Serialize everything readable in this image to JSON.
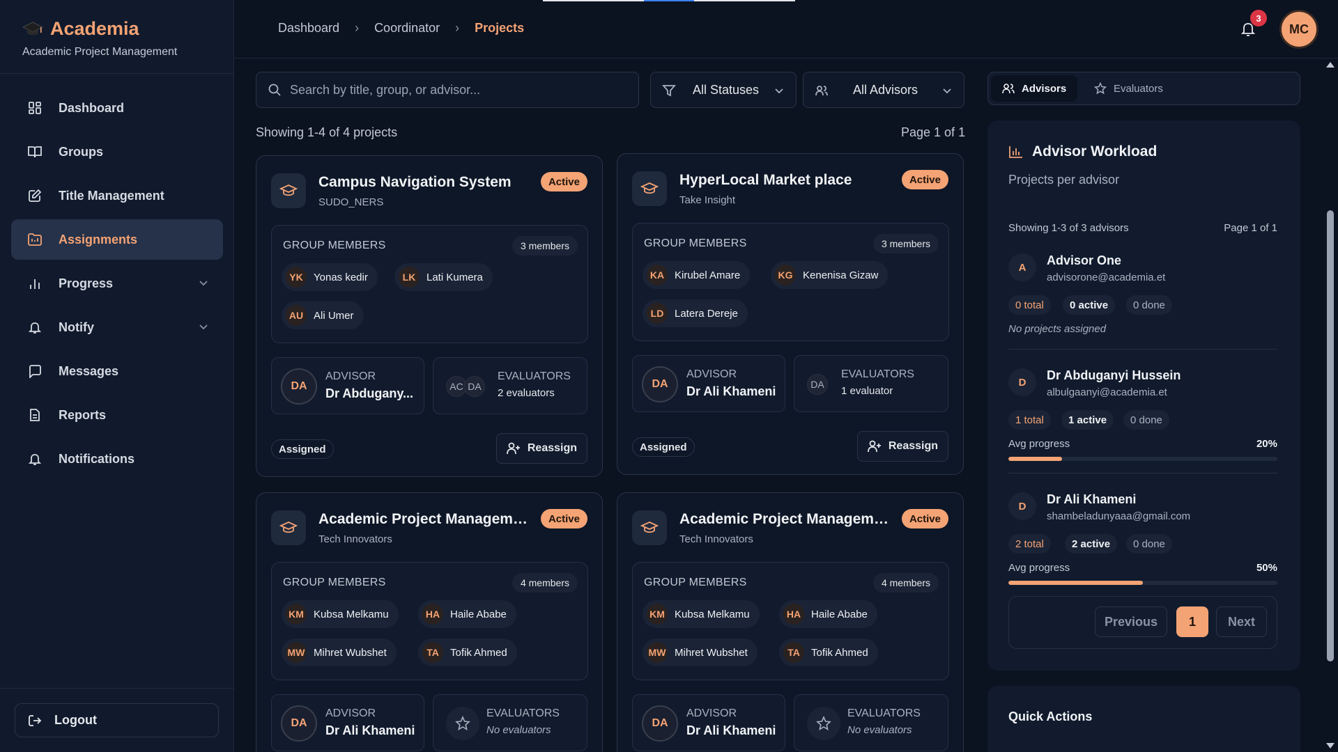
{
  "brand": {
    "name": "Academia",
    "subtitle": "Academic Project Management"
  },
  "nav": [
    {
      "label": "Dashboard",
      "icon": "dashboard-icon"
    },
    {
      "label": "Groups",
      "icon": "book-icon"
    },
    {
      "label": "Title Management",
      "icon": "edit-icon"
    },
    {
      "label": "Assignments",
      "icon": "assignment-icon",
      "active": true
    },
    {
      "label": "Progress",
      "icon": "bar-chart-icon",
      "expandable": true
    },
    {
      "label": "Notify",
      "icon": "bell-icon",
      "expandable": true
    },
    {
      "label": "Messages",
      "icon": "message-icon"
    },
    {
      "label": "Reports",
      "icon": "report-icon"
    },
    {
      "label": "Notifications",
      "icon": "bell-icon"
    }
  ],
  "logout_label": "Logout",
  "breadcrumb": [
    "Dashboard",
    "Coordinator",
    "Projects"
  ],
  "notifications_count": "3",
  "user_initials": "MC",
  "search": {
    "placeholder": "Search by title, group, or advisor..."
  },
  "filters": {
    "status": "All Statuses",
    "advisor": "All Advisors"
  },
  "showing": "Showing 1-4 of 4 projects",
  "page_info": "Page 1 of 1",
  "projects": [
    {
      "title": "Campus Navigation System",
      "group": "SUDO_NERS",
      "status": "Active",
      "members_label": "GROUP MEMBERS",
      "members_count": "3 members",
      "members": [
        {
          "ini": "YK",
          "name": "Yonas kedir"
        },
        {
          "ini": "LK",
          "name": "Lati Kumera"
        },
        {
          "ini": "AU",
          "name": "Ali Umer"
        }
      ],
      "advisor_label": "ADVISOR",
      "advisor_ini": "DA",
      "advisor": "Dr Abduganyi Hussein",
      "evaluators_label": "EVALUATORS",
      "evaluators": "2 evaluators",
      "evaluator_inis": [
        "AC",
        "DA"
      ],
      "assignment": "Assigned",
      "action": "Reassign"
    },
    {
      "title": "HyperLocal Market place",
      "group": "Take Insight",
      "status": "Active",
      "members_label": "GROUP MEMBERS",
      "members_count": "3 members",
      "members": [
        {
          "ini": "KA",
          "name": "Kirubel Amare"
        },
        {
          "ini": "KG",
          "name": "Kenenisa Gizaw"
        },
        {
          "ini": "LD",
          "name": "Latera Dereje"
        }
      ],
      "advisor_label": "ADVISOR",
      "advisor_ini": "DA",
      "advisor": "Dr Ali Khameni",
      "evaluators_label": "EVALUATORS",
      "evaluators": "1 evaluator",
      "evaluator_inis": [
        "DA"
      ],
      "assignment": "Assigned",
      "action": "Reassign"
    },
    {
      "title": "Academic Project Management System",
      "group": "Tech Innovators",
      "status": "Active",
      "members_label": "GROUP MEMBERS",
      "members_count": "4 members",
      "members": [
        {
          "ini": "KM",
          "name": "Kubsa Melkamu"
        },
        {
          "ini": "HA",
          "name": "Haile Ababe"
        },
        {
          "ini": "MW",
          "name": "Mihret Wubshet"
        },
        {
          "ini": "TA",
          "name": "Tofik Ahmed"
        }
      ],
      "advisor_label": "ADVISOR",
      "advisor_ini": "DA",
      "advisor": "Dr Ali Khameni",
      "evaluators_label": "EVALUATORS",
      "evaluators": "No evaluators",
      "evaluator_inis": []
    },
    {
      "title": "Academic Project Management System",
      "group": "Tech Innovators",
      "status": "Active",
      "members_label": "GROUP MEMBERS",
      "members_count": "4 members",
      "members": [
        {
          "ini": "KM",
          "name": "Kubsa Melkamu"
        },
        {
          "ini": "HA",
          "name": "Haile Ababe"
        },
        {
          "ini": "MW",
          "name": "Mihret Wubshet"
        },
        {
          "ini": "TA",
          "name": "Tofik Ahmed"
        }
      ],
      "advisor_label": "ADVISOR",
      "advisor_ini": "DA",
      "advisor": "Dr Ali Khameni",
      "evaluators_label": "EVALUATORS",
      "evaluators": "No evaluators",
      "evaluator_inis": []
    }
  ],
  "right_tabs": [
    "Advisors",
    "Evaluators"
  ],
  "workload": {
    "title": "Advisor Workload",
    "subtitle": "Projects per advisor",
    "showing": "Showing 1-3 of 3 advisors",
    "page": "Page 1 of 1",
    "advisors": [
      {
        "ini": "A",
        "name": "Advisor One",
        "email": "advisorone@academia.et",
        "total": "0 total",
        "active": "0 active",
        "done": "0 done",
        "note": "No projects assigned"
      },
      {
        "ini": "D",
        "name": "Dr Abduganyi Hussein",
        "email": "albulgaanyi@academia.et",
        "total": "1 total",
        "active": "1 active",
        "done": "0 done",
        "progress_label": "Avg progress",
        "progress": "20%",
        "progress_value": 20
      },
      {
        "ini": "D",
        "name": "Dr Ali Khameni",
        "email": "shambeladunyaaa@gmail.com",
        "total": "2 total",
        "active": "2 active",
        "done": "0 done",
        "progress_label": "Avg progress",
        "progress": "50%",
        "progress_value": 50
      }
    ],
    "pager": {
      "prev": "Previous",
      "current": "1",
      "next": "Next"
    }
  },
  "quick_actions_title": "Quick Actions",
  "colors": {
    "accent": "#f4a374",
    "background": "#0b1220",
    "panel": "#111b2d",
    "badge": "#dc3545"
  }
}
